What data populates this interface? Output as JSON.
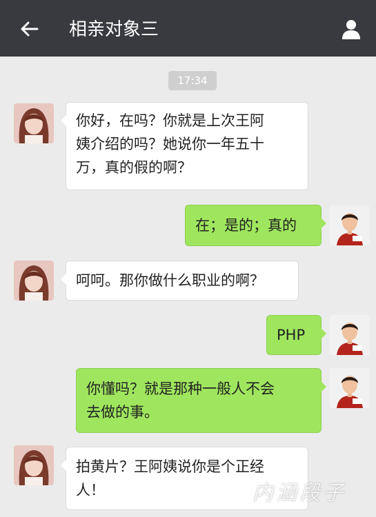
{
  "header": {
    "title": "相亲对象三",
    "back_icon": "back-arrow-icon",
    "profile_icon": "person-icon",
    "background": "#393a3f"
  },
  "timestamp": "17:34",
  "messages": [
    {
      "sender": "contact",
      "text": "你好，在吗？你就是上次王阿\n姨介绍的吗？她说你一年五十\n万，真的假的啊？"
    },
    {
      "sender": "me",
      "text": "在；是的；真的"
    },
    {
      "sender": "contact",
      "text": "呵呵。那你做什么职业的啊？"
    },
    {
      "sender": "me",
      "text": "PHP"
    },
    {
      "sender": "me",
      "text": "你懂吗？就是那种一般人不会\n去做的事。"
    },
    {
      "sender": "contact",
      "text": "拍黄片？王阿姨说你是个正经\n人！"
    }
  ],
  "watermark": "内涵段子",
  "colors": {
    "chat_background": "#ebebeb",
    "incoming_bubble": "#ffffff",
    "outgoing_bubble": "#9fe65e"
  }
}
